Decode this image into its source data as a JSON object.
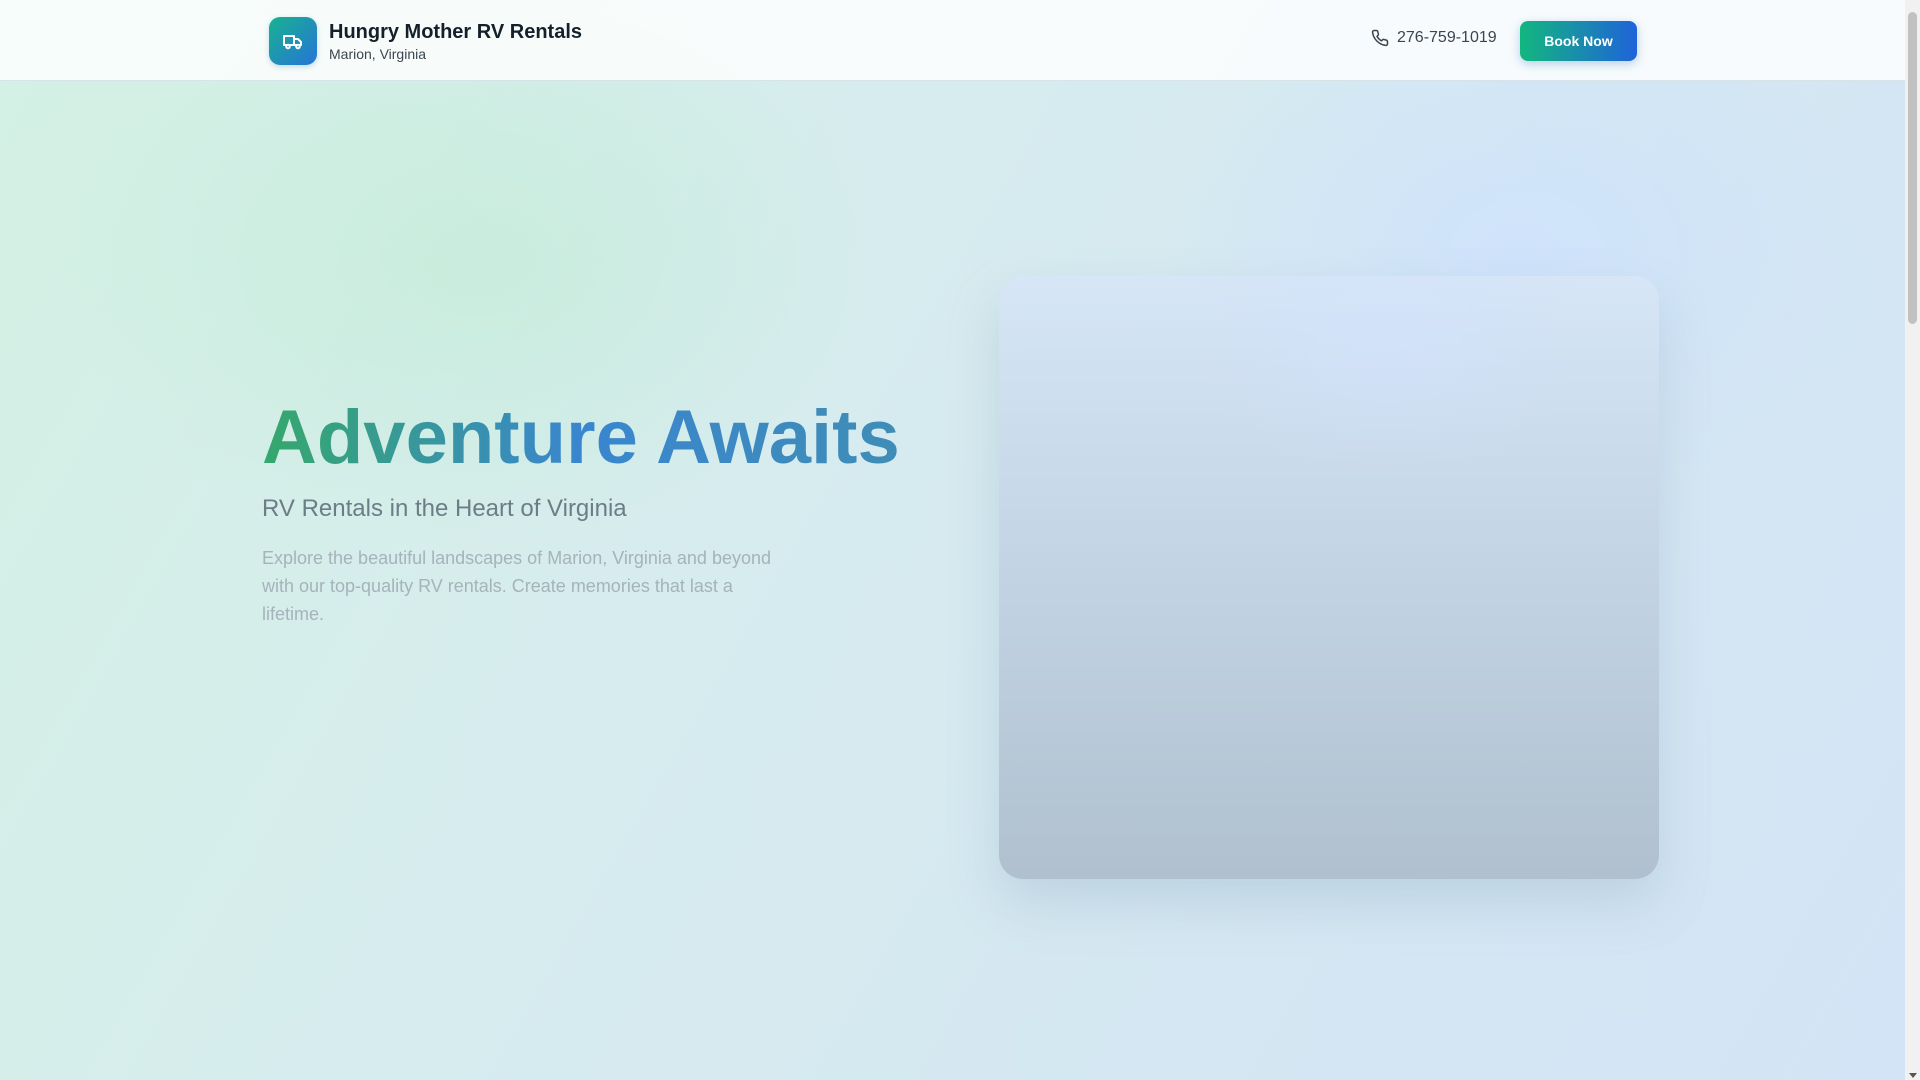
{
  "header": {
    "brand_name": "Hungry Mother RV Rentals",
    "brand_location": "Marion, Virginia",
    "logo_icon": "truck-icon",
    "phone_icon": "phone-icon",
    "phone": "276-759-1019",
    "book_label": "Book Now"
  },
  "hero": {
    "title": "Adventure Awaits",
    "subtitle": "RV Rentals in the Heart of Virginia",
    "description": "Explore the beautiful landscapes of Marion, Virginia and beyond with our top-quality RV rentals. Create memories that last a lifetime."
  },
  "colors": {
    "brand_gradient_start": "#13b67f",
    "brand_gradient_end": "#1f63d9",
    "title_green": "#35a86b",
    "title_blue": "#3a86cf"
  }
}
